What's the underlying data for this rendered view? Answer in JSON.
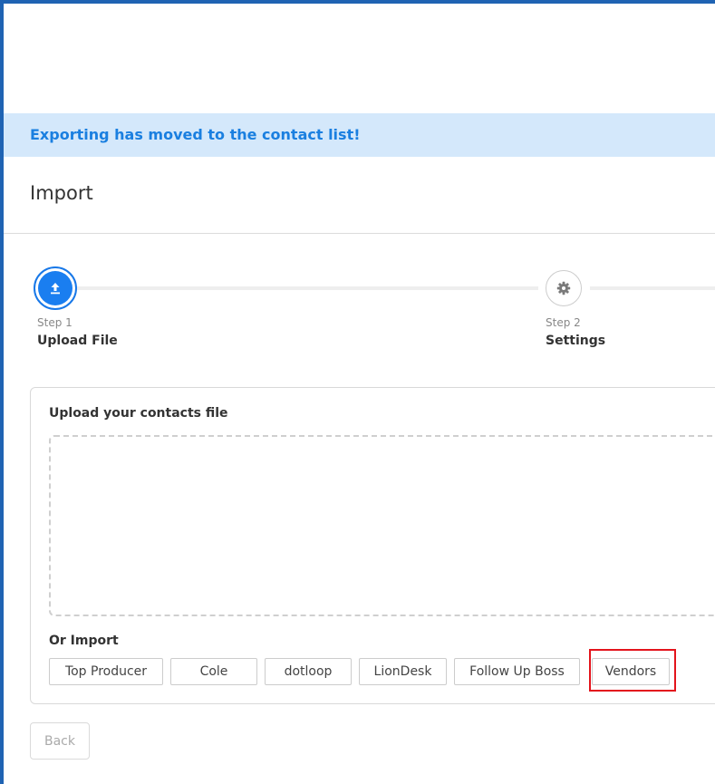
{
  "banner": {
    "message": "Exporting has moved to the contact list!"
  },
  "page": {
    "title": "Import"
  },
  "stepper": {
    "steps": [
      {
        "number": "Step 1",
        "label": "Upload File",
        "icon": "upload-icon",
        "active": true
      },
      {
        "number": "Step 2",
        "label": "Settings",
        "icon": "gear-icon",
        "active": false
      }
    ]
  },
  "upload": {
    "title": "Upload your contacts file",
    "or_import_label": "Or Import",
    "import_sources": [
      "Top Producer",
      "Cole",
      "dotloop",
      "LionDesk",
      "Follow Up Boss",
      "Vendors"
    ]
  },
  "footer": {
    "back_label": "Back"
  },
  "colors": {
    "accent": "#1a7ef0",
    "banner_bg": "#d4e8fb",
    "banner_text": "#1a7fe0",
    "highlight": "#e3141c"
  }
}
